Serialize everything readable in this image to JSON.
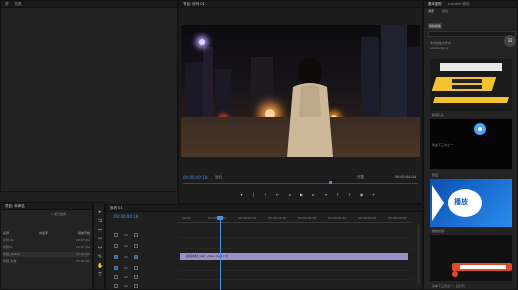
{
  "program": {
    "title": "节目: 序列 01",
    "timecode_left": "00:00:00:18",
    "fit": "适合",
    "full": "完整",
    "timecode_right": "00:00:04:04"
  },
  "graphics": {
    "tabs": [
      "基本图形",
      "Lumetri 颜色"
    ],
    "subtabs": [
      "浏览",
      "编辑"
    ],
    "chip": "我的模板",
    "row1": "本地模板文件夹",
    "row2": "Adobe Stock",
    "circle": "32",
    "captions": [
      "新闻片头",
      "商业下三分之一",
      "按钮",
      "播放标题",
      "基本下三分之一 - 幻灯片",
      "基本下三分之一 - 单色"
    ],
    "logo_text": "播放"
  },
  "project": {
    "title": "项目: 未命名",
    "filter_label": "1 项已选择",
    "col_name": "名称",
    "col_fps": "帧速率",
    "col_media": "媒体开始",
    "rows": [
      {
        "name": "序列 01",
        "fps": "29.97 fps",
        "start": "00;00;00;00"
      },
      {
        "name": "视频01",
        "fps": "29.97 fps",
        "start": "00;00;00;00"
      },
      {
        "name": "视频_1080p",
        "fps": "25.00 fps",
        "start": "00;00;00;00"
      },
      {
        "name": "视频_标准",
        "fps": "25.00 fps",
        "start": "00;00;00;00"
      }
    ]
  },
  "timeline": {
    "title": "序列 01",
    "timecode": "00:00:00:18",
    "ticks": [
      "00:00",
      "00:00:00:15",
      "00:00:01:00",
      "00:00:01:15",
      "00:00:02:00",
      "00:00:02:15",
      "00:00:03:00",
      "00:00:03:15"
    ],
    "tracks": [
      "V3",
      "V2",
      "V1",
      "A1",
      "A2",
      "A3"
    ],
    "clip_label": "视频素材_test_video.mp4 [V]"
  },
  "colors": {
    "accent": "#4a90e2",
    "clip": "#9b8fc8"
  }
}
